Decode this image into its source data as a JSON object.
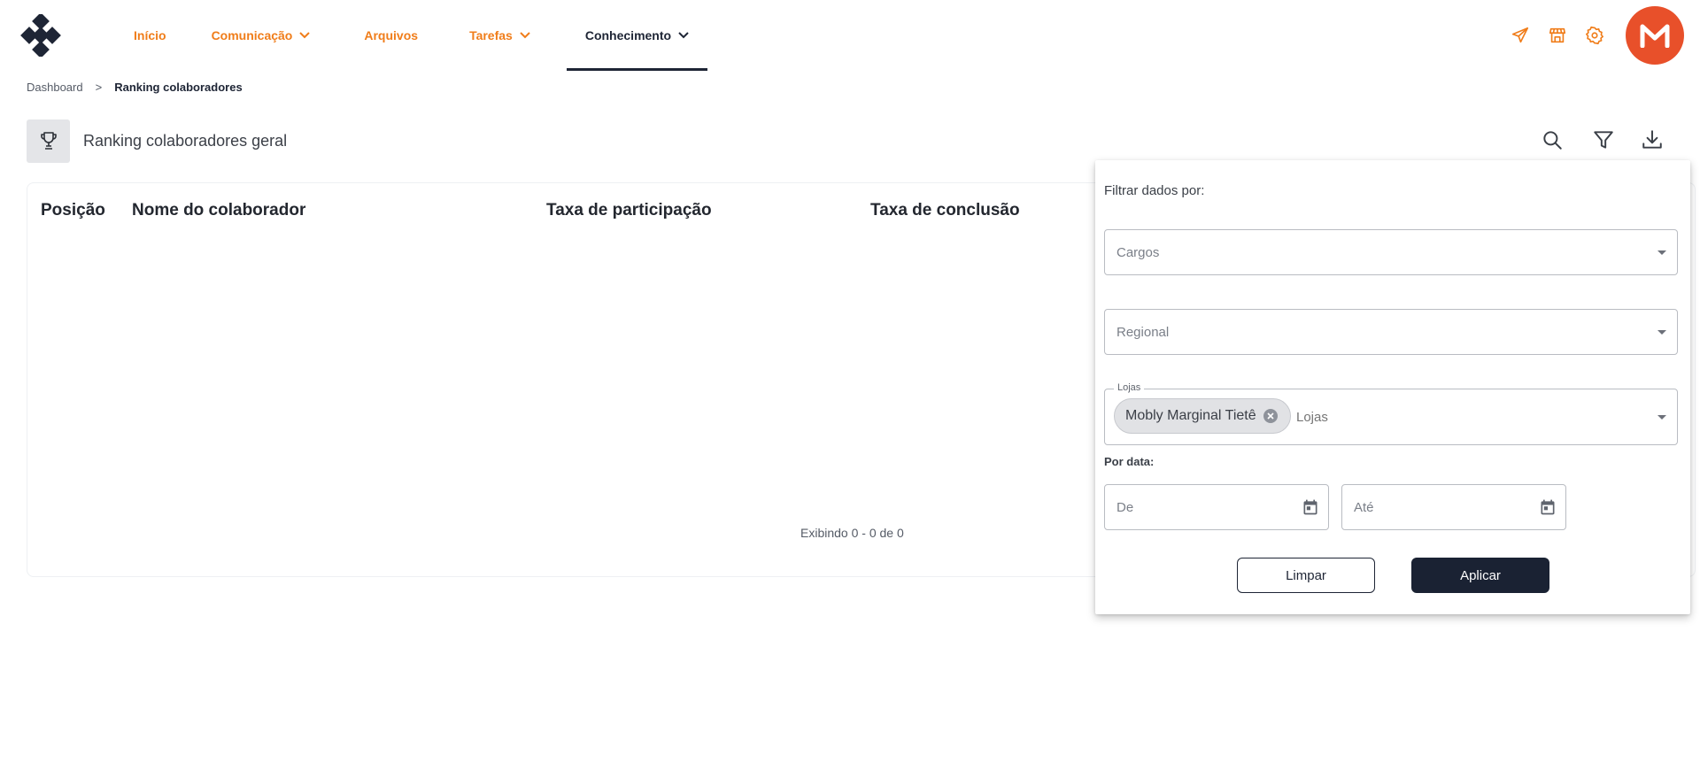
{
  "nav": {
    "items": [
      {
        "label": "Início",
        "has_dropdown": false,
        "active": false
      },
      {
        "label": "Comunicação",
        "has_dropdown": true,
        "active": false
      },
      {
        "label": "Arquivos",
        "has_dropdown": false,
        "active": false
      },
      {
        "label": "Tarefas",
        "has_dropdown": true,
        "active": false
      },
      {
        "label": "Conhecimento",
        "has_dropdown": true,
        "active": true
      }
    ],
    "right_icons": [
      "send-icon",
      "store-icon",
      "settings-icon"
    ],
    "avatar_letter": "M"
  },
  "breadcrumb": {
    "root": "Dashboard",
    "separator": ">",
    "current": "Ranking colaboradores"
  },
  "page": {
    "title": "Ranking colaboradores geral",
    "title_icon": "trophy-icon",
    "actions": [
      "search-icon",
      "filter-icon",
      "download-icon"
    ]
  },
  "table": {
    "columns": [
      "Posição",
      "Nome do colaborador",
      "Taxa de participação",
      "Taxa de conclusão"
    ],
    "rows": [],
    "footer": "Exibindo 0 - 0 de 0"
  },
  "filter": {
    "title": "Filtrar dados por:",
    "cargos_placeholder": "Cargos",
    "regional_placeholder": "Regional",
    "lojas_label": "Lojas",
    "lojas_selected": [
      "Mobly Marginal Tietê"
    ],
    "lojas_placeholder": "Lojas",
    "date_label": "Por data:",
    "date_from_placeholder": "De",
    "date_to_placeholder": "Até",
    "clear_label": "Limpar",
    "apply_label": "Aplicar"
  },
  "colors": {
    "accent": "#f07d1a",
    "dark": "#1e2535",
    "avatar": "#e8502a"
  }
}
